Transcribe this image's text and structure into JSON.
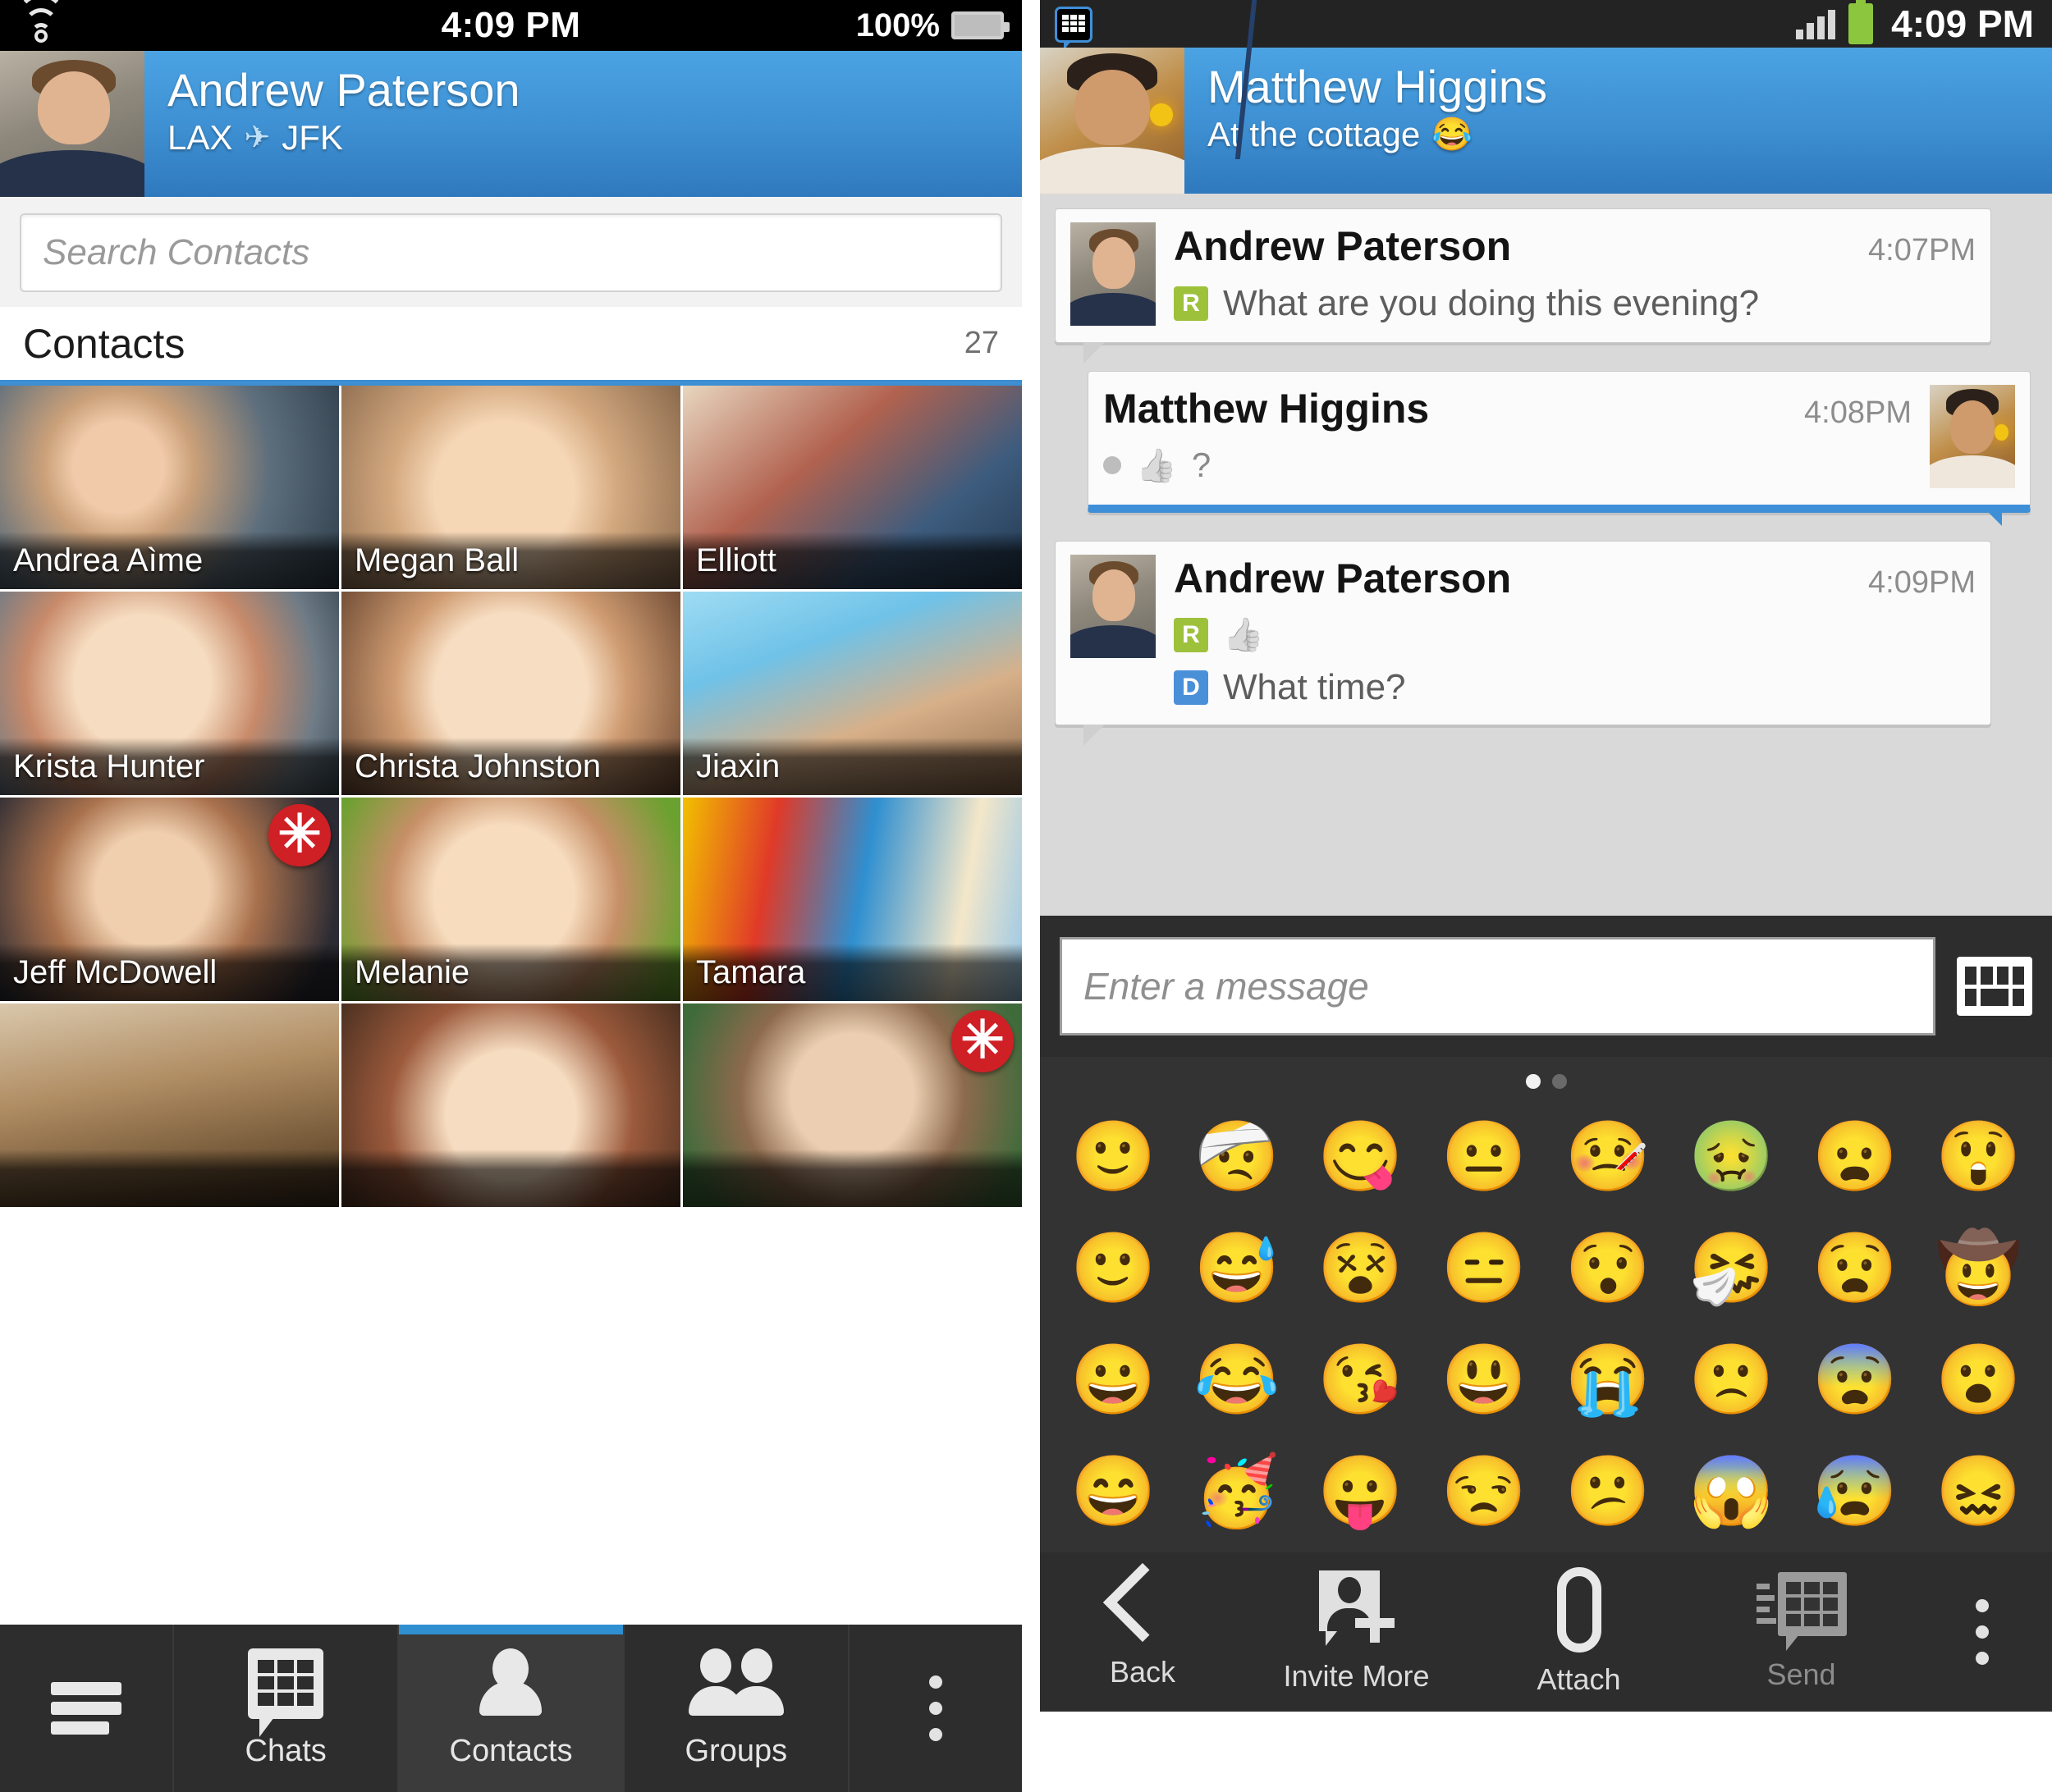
{
  "left_phone": {
    "status_bar": {
      "time": "4:09 PM",
      "battery_percent": "100%",
      "wifi_icon": "wifi-icon",
      "battery_icon": "battery-icon"
    },
    "profile": {
      "name": "Andrew Paterson",
      "status_from": "LAX",
      "status_icon": "airplane-icon",
      "status_to": "JFK",
      "avatar": "avatar"
    },
    "search": {
      "placeholder": "Search Contacts",
      "value": ""
    },
    "list_header": {
      "title": "Contacts",
      "count": "27"
    },
    "contacts": [
      {
        "name": "Andrea Aìme",
        "badge": ""
      },
      {
        "name": "Megan Ball",
        "badge": ""
      },
      {
        "name": "Elliott",
        "badge": ""
      },
      {
        "name": "Krista Hunter",
        "badge": ""
      },
      {
        "name": "Christa Johnston",
        "badge": ""
      },
      {
        "name": "Jiaxin",
        "badge": ""
      },
      {
        "name": "Jeff McDowell",
        "badge": "✳"
      },
      {
        "name": "Melanie",
        "badge": ""
      },
      {
        "name": "Tamara",
        "badge": ""
      },
      {
        "name": "",
        "badge": ""
      },
      {
        "name": "",
        "badge": ""
      },
      {
        "name": "",
        "badge": "✳"
      }
    ],
    "tabs": [
      {
        "label": "",
        "icon": "hamburger-icon",
        "active": false
      },
      {
        "label": "Chats",
        "icon": "bbm-chat-icon",
        "active": false
      },
      {
        "label": "Contacts",
        "icon": "person-icon",
        "active": true
      },
      {
        "label": "Groups",
        "icon": "people-icon",
        "active": false
      },
      {
        "label": "",
        "icon": "kebab-menu-icon",
        "active": false
      }
    ]
  },
  "right_phone": {
    "status_bar": {
      "time": "4:09 PM",
      "app_icon": "bbm-notification-icon",
      "signal_icon": "signal-bars-icon",
      "battery_icon": "battery-icon"
    },
    "profile": {
      "name": "Matthew Higgins",
      "status": "At the cottage",
      "status_emoji": "😂",
      "avatar": "avatar"
    },
    "messages": [
      {
        "sender": "Andrew Paterson",
        "time": "4:07PM",
        "badge": "R",
        "badge_type": "read",
        "text": "What are you doing this evening?",
        "direction": "incoming",
        "emoji": ""
      },
      {
        "sender": "Matthew Higgins",
        "time": "4:08PM",
        "badge": "",
        "badge_type": "",
        "text": "?",
        "direction": "outgoing",
        "emoji": "thumbs-up"
      },
      {
        "sender": "Andrew Paterson",
        "time": "4:09PM",
        "badge": "R",
        "badge_type": "read",
        "text": "",
        "direction": "incoming",
        "emoji": "thumbs-up"
      }
    ],
    "message_extra": {
      "badge": "D",
      "badge_type": "delivered",
      "text": "What time?"
    },
    "composer": {
      "placeholder": "Enter a message",
      "value": "",
      "keyboard_icon": "keyboard-icon"
    },
    "emoji_keyboard": {
      "page_current": 1,
      "page_count": 2,
      "rows": [
        [
          "🙂",
          "🤕",
          "😋",
          "😐",
          "🤒",
          "🤢",
          "😦",
          "😲"
        ],
        [
          "🙂",
          "😅",
          "😵",
          "😑",
          "😯",
          "🤧",
          "😧",
          "🤠"
        ],
        [
          "😀",
          "😂",
          "😘",
          "😃",
          "😭",
          "🙁",
          "😨",
          "😮"
        ],
        [
          "😄",
          "🥳",
          "😛",
          "😒",
          "😕",
          "😱",
          "😰",
          "😖"
        ]
      ]
    },
    "toolbar": [
      {
        "label": "Back",
        "icon": "chevron-left-icon"
      },
      {
        "label": "Invite More",
        "icon": "invite-person-icon"
      },
      {
        "label": "Attach",
        "icon": "paperclip-icon"
      },
      {
        "label": "Send",
        "icon": "bbm-send-icon"
      },
      {
        "label": "",
        "icon": "kebab-menu-icon"
      }
    ]
  },
  "colors": {
    "accent_blue": "#3d8fd2",
    "status_read": "#9ec13c",
    "status_delivered": "#4a90d9",
    "badge_red": "#cf2026"
  }
}
